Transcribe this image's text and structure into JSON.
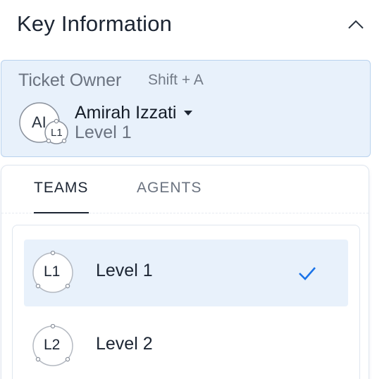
{
  "header": {
    "title": "Key Information",
    "collapse_icon": "chevron-up-icon"
  },
  "owner": {
    "label": "Ticket Owner",
    "shortcut": "Shift + A",
    "avatar_initials": "AI",
    "team_badge": "L1",
    "name": "Amirah Izzati",
    "level": "Level 1",
    "caret_icon": "caret-down-icon"
  },
  "tabs": [
    {
      "label": "TEAMS",
      "active": true
    },
    {
      "label": "AGENTS",
      "active": false
    }
  ],
  "teams": [
    {
      "badge": "L1",
      "label": "Level 1",
      "selected": true
    },
    {
      "badge": "L2",
      "label": "Level 2",
      "selected": false
    }
  ],
  "colors": {
    "accent": "#1a73e8",
    "selected_bg": "#e8f1fb",
    "card_border": "#b9d2ee"
  }
}
